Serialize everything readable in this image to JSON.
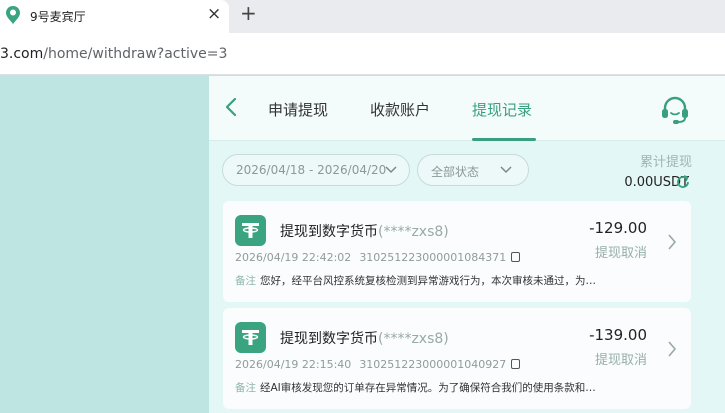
{
  "browser": {
    "tab_title": "9号麦宾厅",
    "close_glyph": "×",
    "new_tab_glyph": "+",
    "url_host": "3.com",
    "url_path": "/home/withdraw?active=3",
    "logo_color": "#3aa37f"
  },
  "nav": {
    "tabs": [
      {
        "label": "申请提现",
        "active": false
      },
      {
        "label": "收款账户",
        "active": false
      },
      {
        "label": "提现记录",
        "active": true
      }
    ],
    "accent_color": "#3a9f7f"
  },
  "filters": {
    "date_range": "2026/04/18 - 2026/04/20",
    "status": "全部状态"
  },
  "summary": {
    "label": "累计提现",
    "value": "0.00USDT"
  },
  "records": [
    {
      "title": "提现到数字货币",
      "account": "(****zxs8)",
      "amount": "-129.00",
      "status": "提现取消",
      "datetime": "2026/04/19 22:42:02",
      "order_id": "310251223000001084371",
      "note_label": "备注",
      "note": "您好，经平台风控系统复核检测到异常游戏行为，本次审核未通过，为…"
    },
    {
      "title": "提现到数字货币",
      "account": "(****zxs8)",
      "amount": "-139.00",
      "status": "提现取消",
      "datetime": "2026/04/19 22:15:40",
      "order_id": "310251223000001040927",
      "note_label": "备注",
      "note": "经AI审核发现您的订单存在异常情况。为了确保符合我们的使用条款和…"
    }
  ]
}
